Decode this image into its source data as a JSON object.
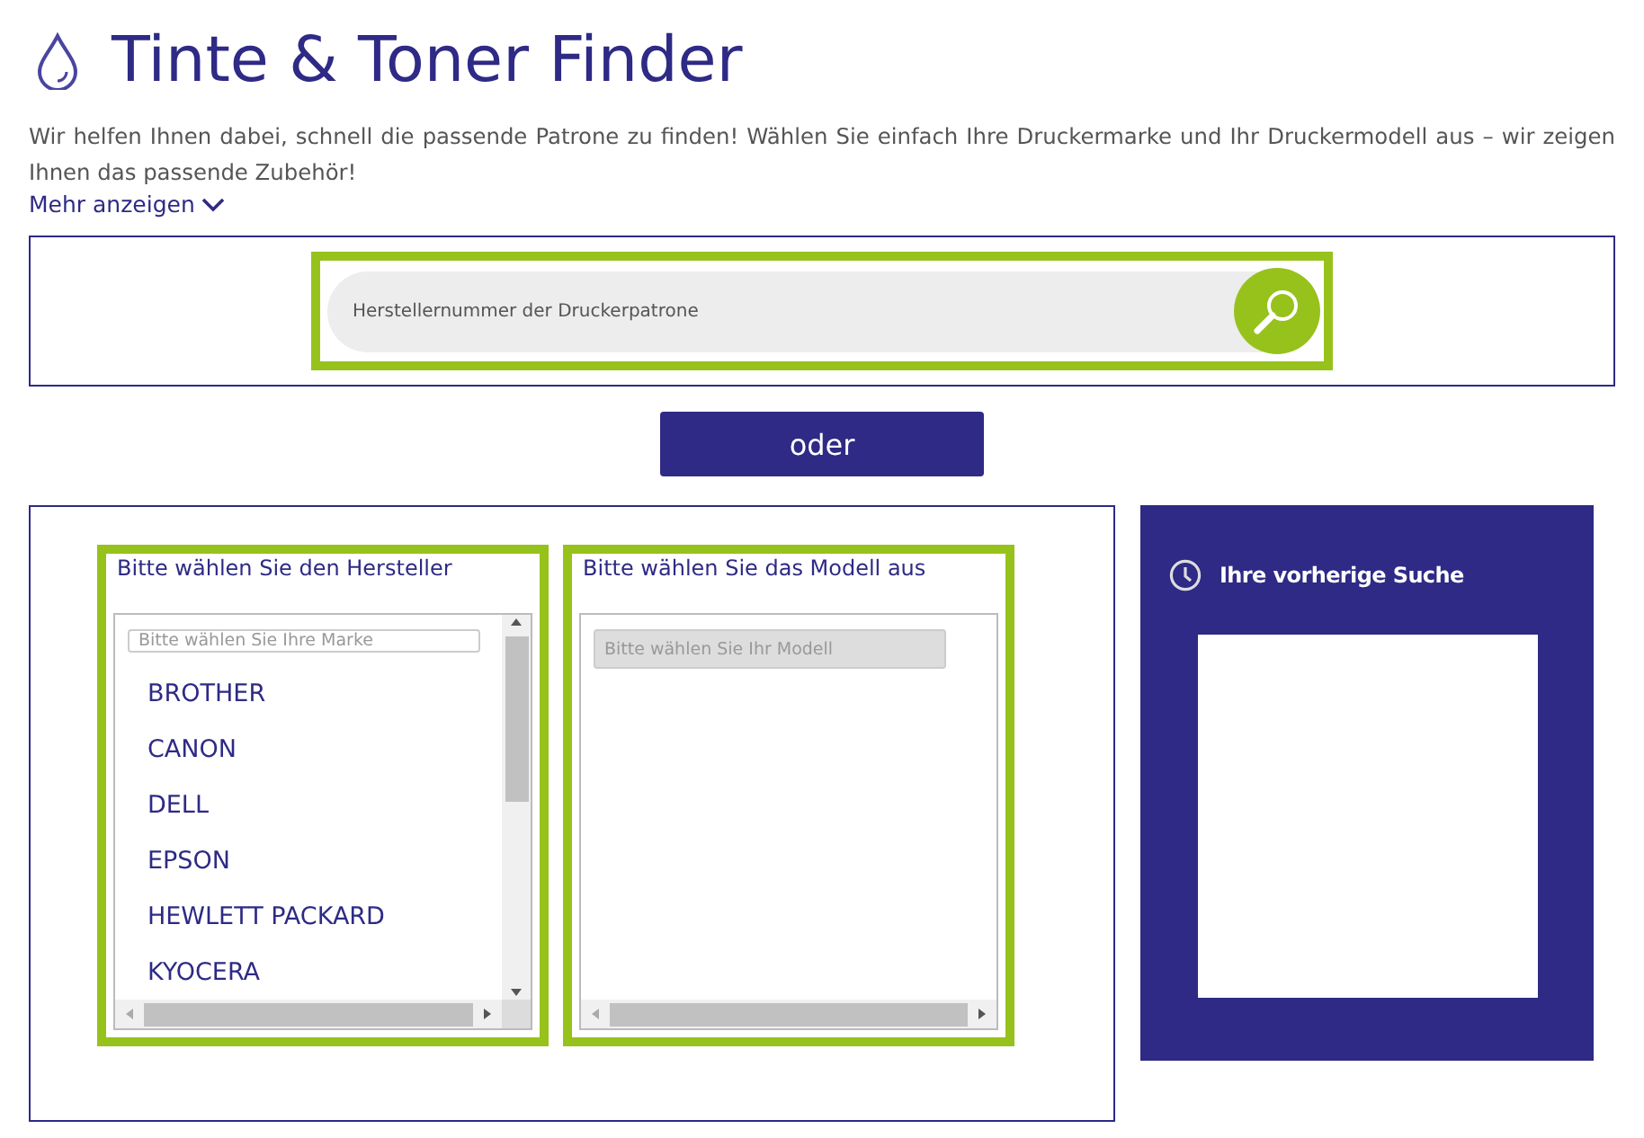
{
  "header": {
    "title": "Tinte & Toner Finder",
    "description": "Wir helfen Ihnen dabei, schnell die passende Patrone zu finden! Wählen Sie einfach Ihre Druckermarke und Ihr Druckermodell aus – wir zeigen Ihnen das passende Zubehör!",
    "more_link": "Mehr anzeigen"
  },
  "search": {
    "placeholder": "Herstellernummer der Druckerpatrone"
  },
  "or_button": "oder",
  "manufacturer": {
    "label": "Bitte wählen Sie den Hersteller",
    "filter": {
      "placeholder": "Bitte wählen Sie Ihre Marke",
      "disabled": false
    },
    "items": [
      "BROTHER",
      "CANON",
      "DELL",
      "EPSON",
      "HEWLETT PACKARD",
      "KYOCERA"
    ]
  },
  "model": {
    "label": "Bitte wählen Sie das Modell aus",
    "filter": {
      "placeholder": "Bitte wählen Sie Ihr Modell",
      "disabled": true
    }
  },
  "history": {
    "title": "Ihre vorherige Suche"
  }
}
